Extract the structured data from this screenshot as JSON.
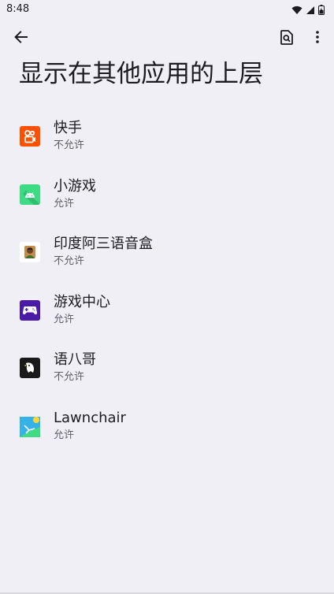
{
  "status_bar": {
    "time": "8:48"
  },
  "toolbar": {
    "back_icon": "arrow-back-icon",
    "search_icon": "search-in-page-icon",
    "more_icon": "more-vert-icon"
  },
  "page": {
    "title": "显示在其他应用的上层"
  },
  "apps": [
    {
      "name": "快手",
      "status": "不允许",
      "icon": "kuaishou-icon",
      "color": "#ff5000"
    },
    {
      "name": "小游戏",
      "status": "允许",
      "icon": "android-icon",
      "color": "#3ddc84"
    },
    {
      "name": "印度阿三语音盒",
      "status": "不允许",
      "icon": "portrait-icon",
      "color": "#ffffff"
    },
    {
      "name": "游戏中心",
      "status": "允许",
      "icon": "gamepad-icon",
      "color": "#4a1aa8"
    },
    {
      "name": "语八哥",
      "status": "不允许",
      "icon": "bird-icon",
      "color": "#1a1a1a"
    },
    {
      "name": "Lawnchair",
      "status": "允许",
      "icon": "lawnchair-icon",
      "color": "#35b3e8"
    }
  ]
}
